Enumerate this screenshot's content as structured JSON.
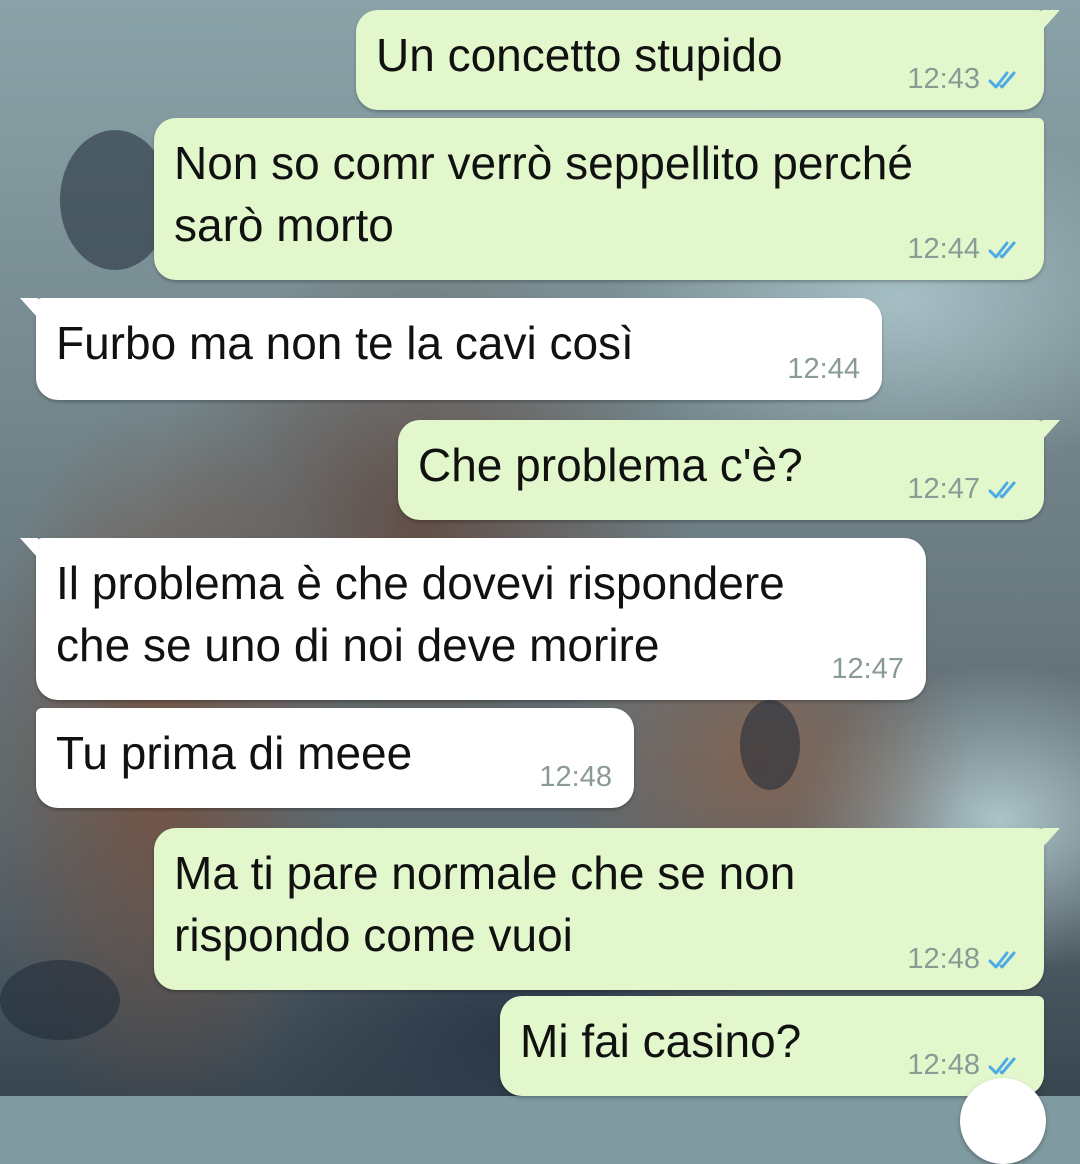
{
  "theme": {
    "outgoing_bubble": "#e2f8cc",
    "incoming_bubble": "#ffffff",
    "read_tick_color": "#4fa9e6"
  },
  "messages": [
    {
      "direction": "outgoing",
      "text": "Un concetto stupido",
      "time": "12:43",
      "status": "read"
    },
    {
      "direction": "outgoing",
      "text": "Non so comr verrò seppellito perché\nsarò morto",
      "time": "12:44",
      "status": "read"
    },
    {
      "direction": "incoming",
      "text": "Furbo ma non te la cavi così",
      "time": "12:44"
    },
    {
      "direction": "outgoing",
      "text": "Che problema c'è?",
      "time": "12:47",
      "status": "read"
    },
    {
      "direction": "incoming",
      "text": "Il problema è che dovevi rispondere\nche se uno di noi deve morire",
      "time": "12:47"
    },
    {
      "direction": "incoming",
      "text": "Tu prima di meee",
      "time": "12:48"
    },
    {
      "direction": "outgoing",
      "text": "Ma ti pare normale che se non\nrispondo come vuoi",
      "time": "12:48",
      "status": "read"
    },
    {
      "direction": "outgoing",
      "text": "Mi fai casino?",
      "time": "12:48",
      "status": "read"
    }
  ]
}
